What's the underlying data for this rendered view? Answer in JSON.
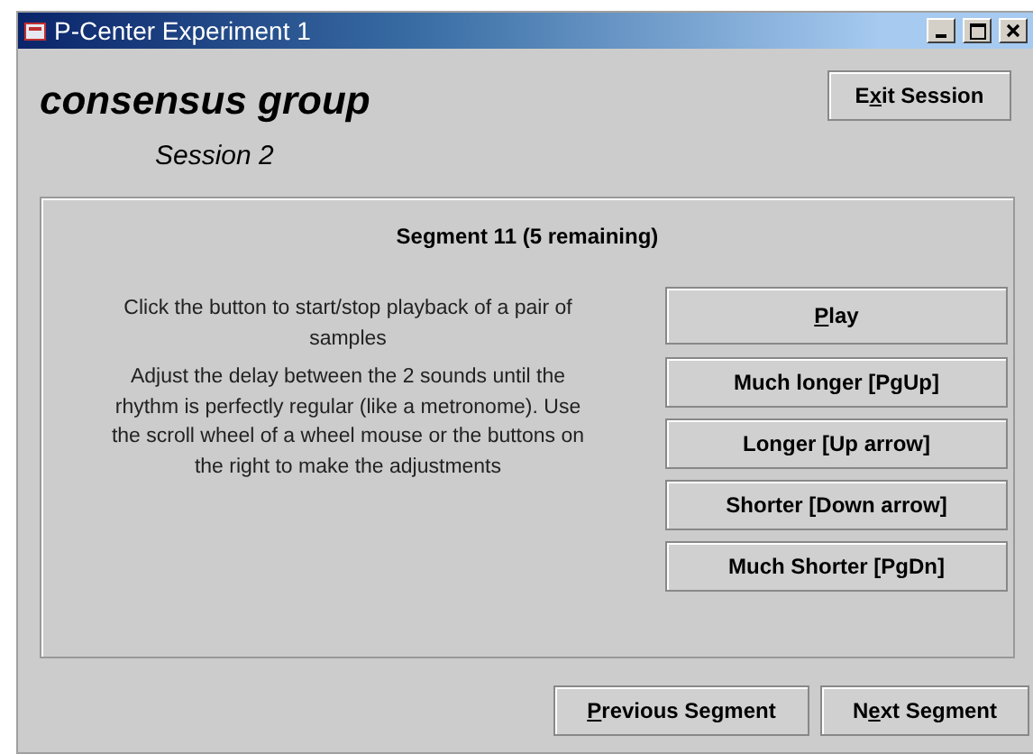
{
  "window": {
    "title": "P-Center Experiment 1"
  },
  "header": {
    "group": "consensus group",
    "session": "Session 2",
    "exit_button": {
      "label_start": "E",
      "mnemonic": "x",
      "label_end": "it Session"
    }
  },
  "panel": {
    "heading": "Segment 11 (5 remaining)",
    "instructions": [
      "Click the button to start/stop playback of a pair of samples",
      "Adjust the delay between the 2 sounds until the rhythm is perfectly regular (like a metronome). Use the scroll wheel of a wheel mouse or the buttons on the right to make the adjustments"
    ],
    "buttons": [
      {
        "mnemonic": "P",
        "label_end": "lay",
        "kind": "large"
      },
      {
        "label_end": "Much longer [PgUp]",
        "kind": "normal"
      },
      {
        "label_end": "Longer [Up arrow]",
        "kind": "normal"
      },
      {
        "label_end": "Shorter [Down arrow]",
        "kind": "normal"
      },
      {
        "label_end": "Much Shorter [PgDn]",
        "kind": "normal"
      }
    ]
  },
  "footer_buttons": [
    {
      "mnemonic": "P",
      "label_end": "revious Segment"
    },
    {
      "label_start": "N",
      "mnemonic": "e",
      "label_end": "xt Segment"
    }
  ]
}
